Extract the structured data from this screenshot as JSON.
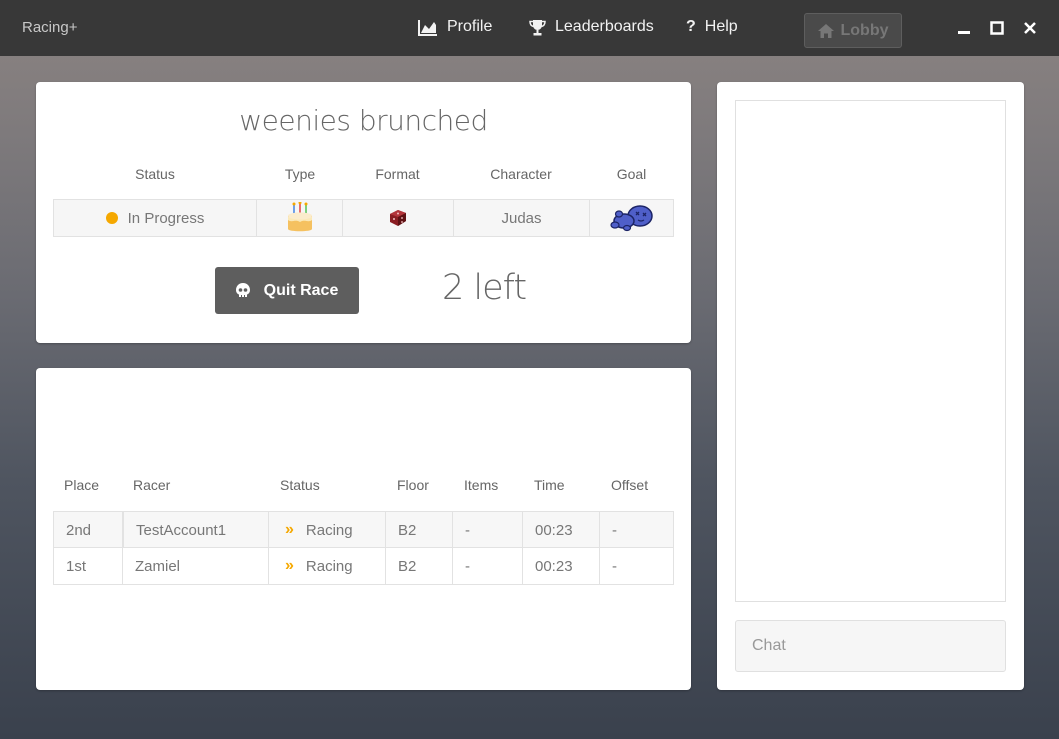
{
  "app": {
    "title": "Racing+"
  },
  "nav": {
    "profile": "Profile",
    "leaderboards": "Leaderboards",
    "help": "Help",
    "lobby": "Lobby"
  },
  "race": {
    "title": "weenies brunched",
    "headers": {
      "status": "Status",
      "type": "Type",
      "format": "Format",
      "character": "Character",
      "goal": "Goal"
    },
    "status": "In Progress",
    "status_color": "#f5a800",
    "type_icon": "cake-icon",
    "format_icon": "dice-icon",
    "character": "Judas",
    "goal_icon": "blue-baby-icon",
    "quit_label": "Quit Race",
    "remaining": "2 left"
  },
  "racers": {
    "headers": {
      "place": "Place",
      "racer": "Racer",
      "status": "Status",
      "floor": "Floor",
      "items": "Items",
      "time": "Time",
      "offset": "Offset"
    },
    "rows": [
      {
        "place": "2nd",
        "racer": "TestAccount1",
        "status": "Racing",
        "floor": "B2",
        "items": "-",
        "time": "00:23",
        "offset": "-"
      },
      {
        "place": "1st",
        "racer": "Zamiel",
        "status": "Racing",
        "floor": "B2",
        "items": "-",
        "time": "00:23",
        "offset": "-"
      }
    ]
  },
  "chat": {
    "placeholder": "Chat"
  }
}
